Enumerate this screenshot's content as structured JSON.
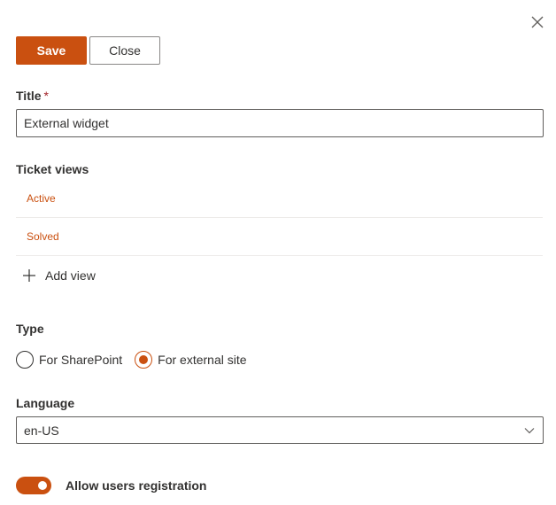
{
  "panel": {
    "close_icon": "close-icon"
  },
  "toolbar": {
    "save_label": "Save",
    "close_label": "Close"
  },
  "title_field": {
    "label": "Title",
    "required_marker": "*",
    "value": "External widget"
  },
  "ticket_views": {
    "label": "Ticket views",
    "items": [
      {
        "label": "Active"
      },
      {
        "label": "Solved"
      }
    ],
    "add_label": "Add view",
    "add_icon": "plus-icon"
  },
  "type_field": {
    "label": "Type",
    "options": [
      {
        "label": "For SharePoint",
        "selected": false
      },
      {
        "label": "For external site",
        "selected": true
      }
    ]
  },
  "language_field": {
    "label": "Language",
    "selected": "en-US",
    "chevron_icon": "chevron-down-icon"
  },
  "registration_toggle": {
    "label": "Allow users registration",
    "on": true
  },
  "colors": {
    "accent": "#ca5010",
    "text": "#323130",
    "border": "#605e5c",
    "divider": "#edebe9"
  }
}
